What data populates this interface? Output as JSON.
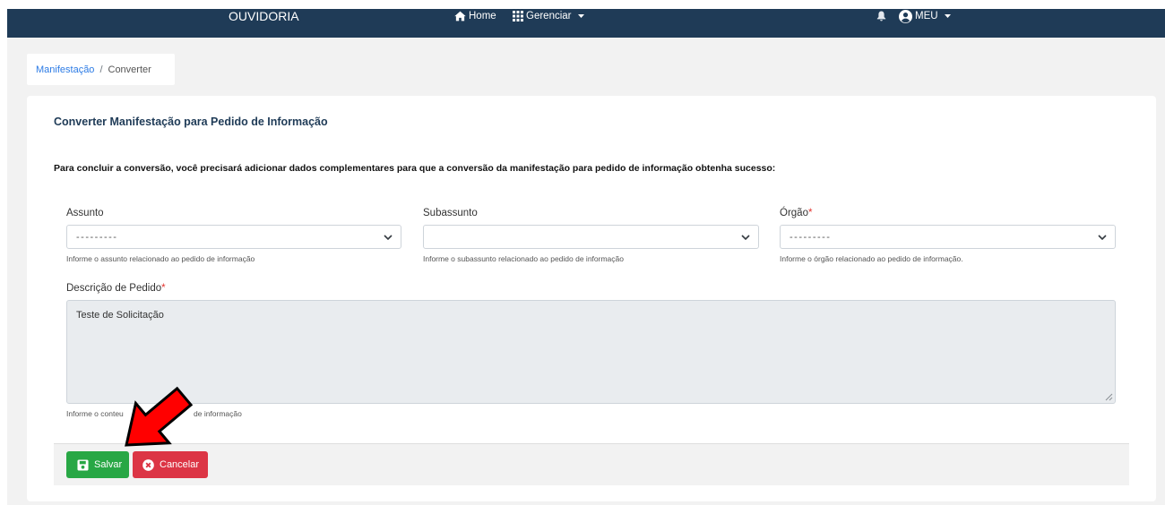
{
  "navbar": {
    "brand": "OUVIDORIA",
    "home_label": "Home",
    "manage_label": "Gerenciar",
    "user_label": "MEU",
    "icons": {
      "home": "home-icon",
      "manage": "grid-icon",
      "notifications": "bell-icon",
      "user": "user-circle-icon",
      "dropdown": "caret-down-icon"
    }
  },
  "breadcrumb": {
    "link": "Manifestação",
    "separator": "/",
    "current": "Converter"
  },
  "card": {
    "title": "Converter Manifestação para Pedido de Informação",
    "intro": "Para concluir a conversão, você precisará adicionar dados complementares para que a conversão da manifestação para pedido de informação obtenha sucesso:"
  },
  "form": {
    "assunto": {
      "label": "Assunto",
      "value": "---------",
      "help": "Informe o assunto relacionado ao pedido de informação"
    },
    "subassunto": {
      "label": "Subassunto",
      "help": "Informe o subassunto relacionado ao pedido de informação"
    },
    "orgao": {
      "label": "Órgão",
      "required_mark": "*",
      "value": "---------",
      "help": "Informe o órgão relacionado ao pedido de informação."
    },
    "descricao": {
      "label": "Descrição de Pedido",
      "required_mark": "*",
      "value": "Teste de Solicitação",
      "help_parts": [
        "Informe o conteu",
        "de informação"
      ]
    }
  },
  "actions": {
    "save_label": "Salvar",
    "save_icon": "floppy-disk-icon",
    "cancel_label": "Cancelar",
    "cancel_icon": "x-circle-icon"
  },
  "theme": {
    "navbar_bg": "#1f3b57",
    "page_bg": "#f2f2f2",
    "link": "#2c7be5",
    "title": "#1f3b57",
    "required": "#e3342f",
    "save_bg": "#28a745",
    "cancel_bg": "#dc3545",
    "textarea_bg": "#e9ecef",
    "annotation_arrow": "#ff0000"
  }
}
